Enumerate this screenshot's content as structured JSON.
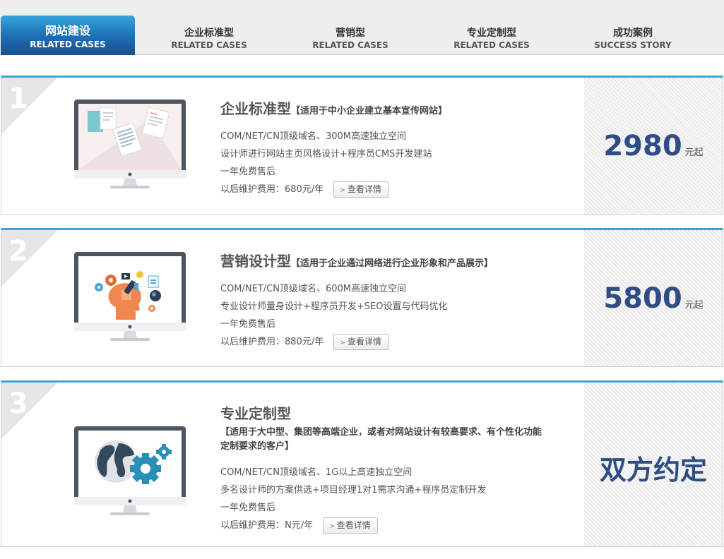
{
  "tabs": [
    {
      "title": "网站建设",
      "subtitle": "RELATED CASES",
      "active": true
    },
    {
      "title": "企业标准型",
      "subtitle": "RELATED CASES",
      "active": false
    },
    {
      "title": "营销型",
      "subtitle": "RELATED CASES",
      "active": false
    },
    {
      "title": "专业定制型",
      "subtitle": "RELATED CASES",
      "active": false
    },
    {
      "title": "成功案例",
      "subtitle": "SUCCESS STORY",
      "active": false
    }
  ],
  "packages": [
    {
      "number": "1",
      "title": "企业标准型",
      "subtitle": "【适用于中小企业建立基本宣传网站】",
      "features": [
        "COM/NET/CN顶级域名、300M高速独立空间",
        "设计师进行网站主页风格设计+程序员CMS开发建站",
        "一年免费售后"
      ],
      "fee_label": "以后维护费用：680元/年",
      "detail_button": "查看详情",
      "price": "2980",
      "price_unit": "元起",
      "illustration": "documents"
    },
    {
      "number": "2",
      "title": "营销设计型",
      "subtitle": "【适用于企业通过网络进行企业形象和产品展示】",
      "features": [
        "COM/NET/CN顶级域名、600M高速独立空间",
        "专业设计师量身设计+程序员开发+SEO设置与代码优化",
        "一年免费售后"
      ],
      "fee_label": "以后维护费用：880元/年",
      "detail_button": "查看详情",
      "price": "5800",
      "price_unit": "元起",
      "illustration": "marketing-head"
    },
    {
      "number": "3",
      "title": "专业定制型",
      "subtitle": "【适用于大中型、集团等高端企业，或者对网站设计有较高要求、有个性化功能定制要求的客户】",
      "features": [
        "COM/NET/CN顶级域名、1G以上高速独立空间",
        "多名设计师的方案供选+项目经理1对1需求沟通+程序员定制开发",
        "一年免费售后"
      ],
      "fee_label": "以后维护费用：N元/年",
      "detail_button": "查看详情",
      "price_text": "双方约定",
      "illustration": "globe-gears"
    }
  ],
  "colors": {
    "accent_blue": "#3ea4d6",
    "price_blue": "#2f4d84",
    "tab_active": "#1d6db3"
  }
}
